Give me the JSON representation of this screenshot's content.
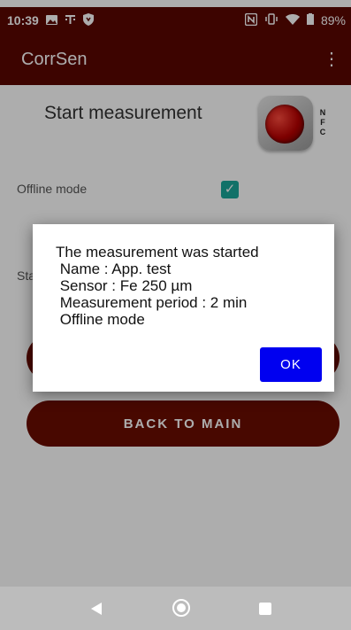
{
  "status_bar": {
    "time": "10:39",
    "battery": "89%",
    "icons_left": [
      "image-icon",
      "t-mobile-icon",
      "shield-icon"
    ],
    "icons_right": [
      "nfc-icon",
      "vibrate-icon",
      "wifi-icon",
      "battery-icon"
    ]
  },
  "app_bar": {
    "title": "CorrSen",
    "menu_icon": "overflow-menu-icon"
  },
  "main": {
    "start_title": "Start measurement",
    "nfc_letters": "N F C",
    "offline_label": "Offline mode",
    "offline_checked": true,
    "partial_label": "Sta",
    "back_button_label": "BACK TO MAIN"
  },
  "dialog": {
    "line1": "The measurement was started",
    "line2": " Name : App. test",
    "line3": " Sensor : Fe 250 µm",
    "line4": " Measurement period : 2 min",
    "line5": " Offline mode",
    "ok_label": "OK"
  },
  "nav": {
    "back_icon": "back-icon",
    "home_icon": "home-icon",
    "recents_icon": "recents-icon"
  },
  "colors": {
    "primary_dark": "#5a0700",
    "button": "#6a0c00",
    "checkbox": "#1aa79a",
    "dialog_button": "#0000f0"
  }
}
